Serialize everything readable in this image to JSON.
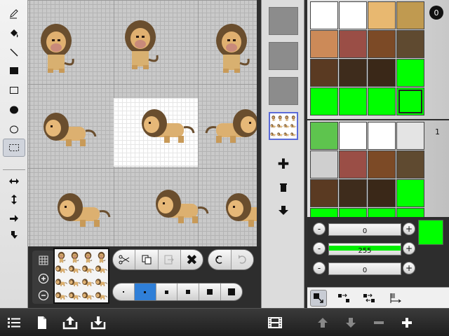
{
  "canvas": {
    "background": "#c9c9c9",
    "highlight_cell": "white"
  },
  "tools": [
    {
      "name": "pencil-tool",
      "icon": "pencil-icon"
    },
    {
      "name": "fill-tool",
      "icon": "paint-bucket-icon"
    },
    {
      "name": "line-tool",
      "icon": "line-icon"
    },
    {
      "name": "filled-rect-tool",
      "icon": "filled-rectangle-icon"
    },
    {
      "name": "rect-tool",
      "icon": "rectangle-icon"
    },
    {
      "name": "filled-ellipse-tool",
      "icon": "filled-ellipse-icon"
    },
    {
      "name": "ellipse-tool",
      "icon": "ellipse-icon"
    },
    {
      "name": "selection-tool",
      "icon": "dashed-selection-icon",
      "selected": true
    },
    {
      "name": "flip-horizontal-tool",
      "icon": "flip-horizontal-icon"
    },
    {
      "name": "flip-vertical-tool",
      "icon": "flip-vertical-icon"
    },
    {
      "name": "rotate-left-tool",
      "icon": "rotate-left-icon"
    },
    {
      "name": "rotate-right-tool",
      "icon": "rotate-right-icon"
    }
  ],
  "edit_buttons": {
    "cut": "scissors-icon",
    "copy": "copy-icon",
    "paste": "paste-icon",
    "delete": "delete-x-icon",
    "undo": "undo-icon",
    "redo": "redo-icon"
  },
  "brush_sizes": {
    "count": 6,
    "selected_index": 1
  },
  "layers": {
    "slots": 4,
    "active_index": 3
  },
  "palette": {
    "page1": {
      "number": "0",
      "swatches": [
        "#ffffff",
        "#ffffff",
        "#e8b870",
        "#c09a50",
        "#cc8a58",
        "#9a4e46",
        "#7c4a26",
        "#5f4a30",
        "#5a3a22",
        "#3e2c1c",
        "#3a2818",
        "#00ff00",
        "#00ff00",
        "#00ff00",
        "#00ff00",
        "#00ff00"
      ],
      "selected_index": 15
    },
    "page2": {
      "number": "1",
      "swatches": [
        "#5ec44e",
        "#ffffff",
        "#ffffff",
        "#e4e4e4",
        "#cfcfcf",
        "#9a4e46",
        "#7c4a26",
        "#5f4a30",
        "#5a3a22",
        "#3e2c1c",
        "#3a2818",
        "#00ff00",
        "#00ff00",
        "#00ff00",
        "#00ff00",
        "#00ff00"
      ]
    }
  },
  "color_sliders": [
    {
      "name": "red",
      "value": "0",
      "level": 0
    },
    {
      "name": "green",
      "value": "255",
      "level": 1
    },
    {
      "name": "blue",
      "value": "0",
      "level": 0
    }
  ],
  "current_color": "#00ff00",
  "modes": [
    "pointer-mode-icon",
    "swap-right-icon",
    "swap-both-icon",
    "gradient-mode-icon"
  ],
  "bottom_bar": {
    "left": [
      "list-icon",
      "new-document-icon",
      "export-icon",
      "import-icon"
    ],
    "right": [
      "filmstrip-icon",
      "arrow-up-icon",
      "arrow-down-icon",
      "minus-icon",
      "plus-icon"
    ]
  }
}
